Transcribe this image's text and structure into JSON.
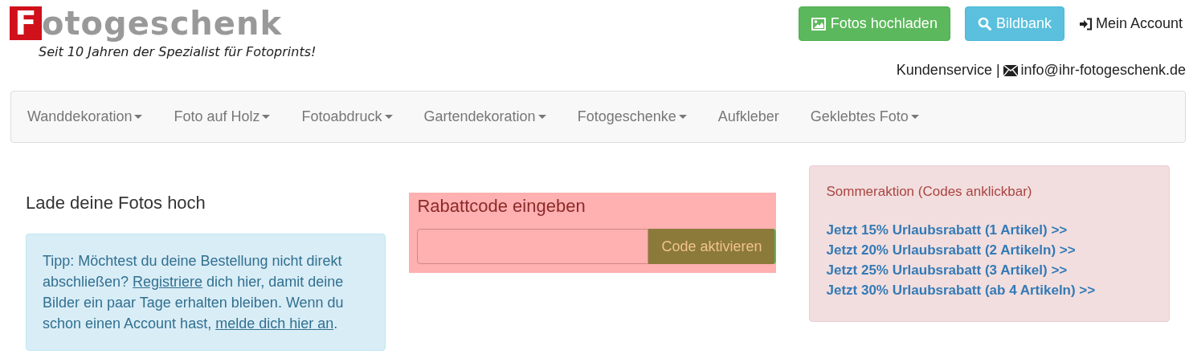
{
  "logo": {
    "initial": "F",
    "rest": "otogeschenk",
    "tagline": "Seit 10 Jahren der Spezialist für Fotoprints!"
  },
  "header_buttons": [
    {
      "kind": "upload",
      "label": "Fotos hochladen"
    },
    {
      "kind": "search",
      "label": "Bildbank"
    }
  ],
  "account_link": "Mein Account",
  "contact": {
    "label": "Kundenservice",
    "separator": "|",
    "email": "info@ihr-fotogeschenk.de"
  },
  "nav": [
    {
      "label": "Wanddekoration",
      "has_dropdown": true
    },
    {
      "label": "Foto auf Holz",
      "has_dropdown": true
    },
    {
      "label": "Fotoabdruck",
      "has_dropdown": true
    },
    {
      "label": "Gartendekoration",
      "has_dropdown": true
    },
    {
      "label": "Fotogeschenke",
      "has_dropdown": true
    },
    {
      "label": "Aufkleber",
      "has_dropdown": false
    },
    {
      "label": "Geklebtes Foto",
      "has_dropdown": true
    }
  ],
  "upload": {
    "heading": "Lade deine Fotos hoch",
    "tip": [
      {
        "kind": "text",
        "text": "Tipp: Möchtest du deine Bestellung nicht direkt abschließen? "
      },
      {
        "kind": "link",
        "text": "Registriere"
      },
      {
        "kind": "text",
        "text": " dich hier, damit deine Bilder ein paar Tage erhalten bleiben. Wenn du schon einen Account hast, "
      },
      {
        "kind": "link",
        "text": "melde dich hier an"
      },
      {
        "kind": "text",
        "text": "."
      }
    ]
  },
  "coupon": {
    "heading": "Rabattcode eingeben",
    "button": "Code aktivieren"
  },
  "promo": {
    "title": "Sommeraktion (Codes anklickbar)",
    "links": [
      "Jetzt 15% Urlaubsrabatt (1 Artikel) >>",
      "Jetzt 20% Urlaubsrabatt (2 Artikeln) >>",
      "Jetzt 25% Urlaubsrabatt (3 Artikel) >>",
      "Jetzt 30% Urlaubsrabatt (ab 4 Artikeln) >>"
    ]
  }
}
